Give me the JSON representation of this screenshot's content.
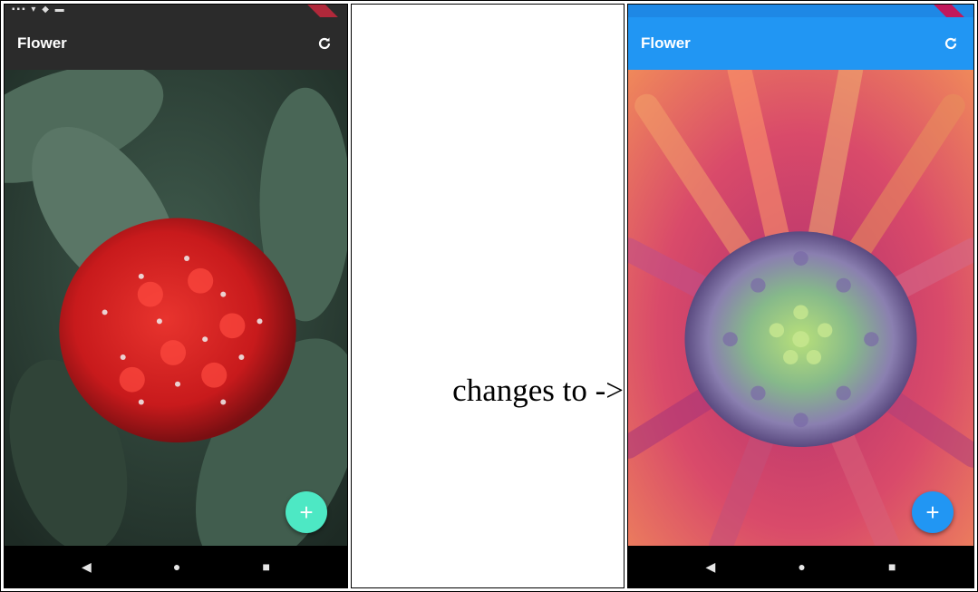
{
  "left_screen": {
    "app_title": "Flower",
    "refresh_icon": "refresh-icon",
    "fab_label": "+",
    "nav": {
      "back": "◀",
      "home": "●",
      "recents": "■"
    },
    "colors": {
      "appbar": "#2b2b2b",
      "fab": "#4de8c4"
    }
  },
  "middle": {
    "caption": "changes to ->"
  },
  "right_screen": {
    "app_title": "Flower",
    "refresh_icon": "refresh-icon",
    "fab_label": "+",
    "nav": {
      "back": "◀",
      "home": "●",
      "recents": "■"
    },
    "colors": {
      "appbar": "#2196f3",
      "fab": "#2196f3"
    }
  }
}
